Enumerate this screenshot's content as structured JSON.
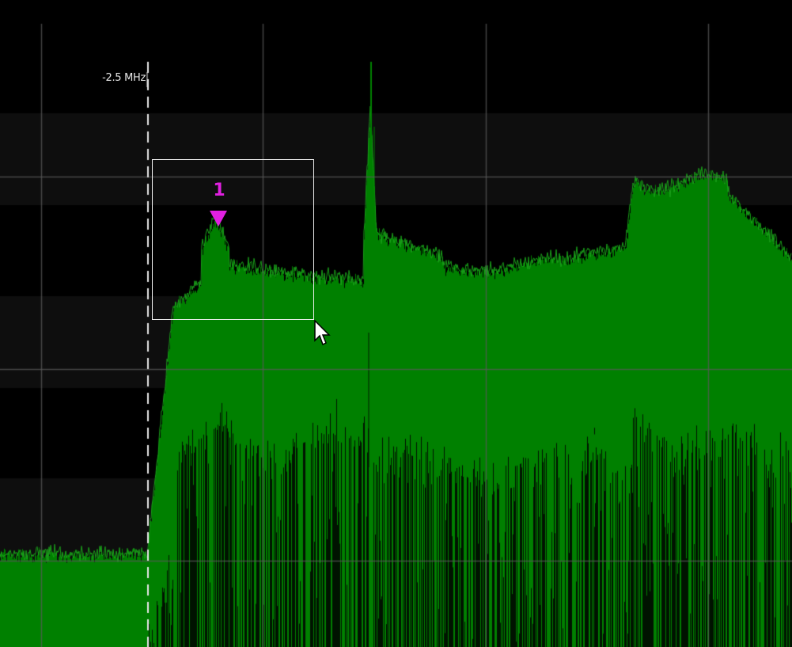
{
  "spectrum": {
    "frequency_line_label": "-2.5 MHz",
    "trace_color": "#008000",
    "trace_edge_color": "#1aa01a",
    "grid_color": "#5a5a5a",
    "band_color": "#0e0e0e",
    "background_color": "#000000"
  },
  "marker": {
    "label": "1",
    "color": "#e020e0",
    "icon": "triangle-down-marker-icon"
  },
  "zoom_selection": {
    "border_color": "#f2f2f2"
  },
  "cursor": {
    "icon": "arrow-pointer-icon"
  }
}
